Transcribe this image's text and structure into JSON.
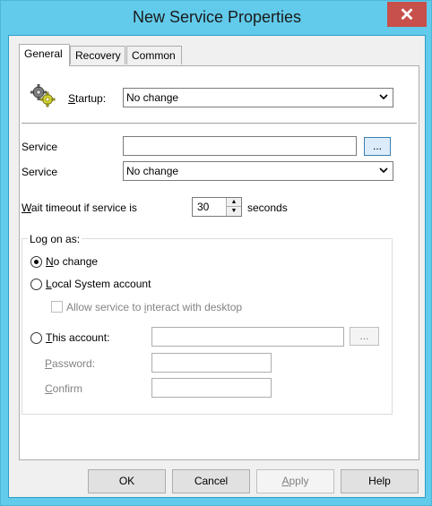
{
  "window": {
    "title": "New Service Properties",
    "close_glyph": "✕"
  },
  "tabs": [
    {
      "label": "General",
      "active": true
    },
    {
      "label": "Recovery",
      "active": false
    },
    {
      "label": "Common",
      "active": false
    }
  ],
  "general": {
    "startup_label_u": "S",
    "startup_label_rest": "tartup:",
    "startup_value": "No change",
    "service_name_label": "Service",
    "service_name_value": "",
    "browse_label": "...",
    "service_action_label": "Service",
    "service_action_value": "No change",
    "wait_label_u": "W",
    "wait_label_rest": "ait timeout if service is",
    "wait_value": "30",
    "wait_units": "seconds"
  },
  "logon": {
    "group_label": "Log on as:",
    "no_change_u": "N",
    "no_change_rest": "o change",
    "local_system_u": "L",
    "local_system_rest": "ocal System account",
    "allow_interact_pre": "Allow service to ",
    "allow_interact_u": "i",
    "allow_interact_post": "nteract with desktop",
    "this_account_u": "T",
    "this_account_rest": "his account:",
    "this_account_value": "",
    "account_browse_label": "...",
    "password_u": "P",
    "password_rest": "assword:",
    "password_value": "",
    "confirm_u": "C",
    "confirm_rest": "onfirm",
    "confirm_value": ""
  },
  "buttons": {
    "ok": "OK",
    "cancel": "Cancel",
    "apply_u": "A",
    "apply_rest": "pply",
    "help": "Help"
  },
  "icons": {
    "gears": "gears-icon",
    "close": "close-icon",
    "dropdown": "chevron-down-icon"
  }
}
